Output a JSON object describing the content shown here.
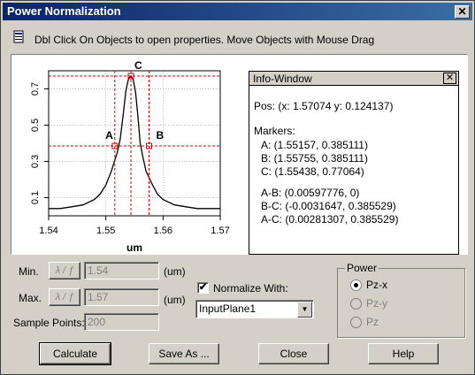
{
  "window": {
    "title": "Power Normalization"
  },
  "hint": "Dbl Click On Objects to open properties.  Move Objects with Mouse Drag",
  "chart_data": {
    "type": "line",
    "xlabel": "um",
    "ylabel": "",
    "xlim": [
      1.54,
      1.57
    ],
    "ylim": [
      0,
      0.8
    ],
    "x_ticks": [
      "1.54",
      "1.55",
      "1.56",
      "1.57"
    ],
    "y_ticks": [
      "0.1",
      "0.3",
      "0.5",
      "0.7"
    ],
    "series": [
      {
        "x": [
          1.54,
          1.542,
          1.544,
          1.546,
          1.548,
          1.549,
          1.55,
          1.551,
          1.552,
          1.5525,
          1.553,
          1.5535,
          1.554,
          1.5544,
          1.5548,
          1.5552,
          1.5556,
          1.556,
          1.5565,
          1.557,
          1.558,
          1.559,
          1.56,
          1.562,
          1.564,
          1.566,
          1.568,
          1.57
        ],
        "y": [
          0.04,
          0.04,
          0.05,
          0.06,
          0.09,
          0.12,
          0.17,
          0.25,
          0.35,
          0.42,
          0.55,
          0.69,
          0.76,
          0.77,
          0.75,
          0.68,
          0.55,
          0.4,
          0.32,
          0.25,
          0.18,
          0.12,
          0.09,
          0.06,
          0.05,
          0.04,
          0.04,
          0.04
        ]
      }
    ],
    "markers": [
      {
        "name": "A",
        "x": 1.55157,
        "y": 0.385111
      },
      {
        "name": "B",
        "x": 1.55755,
        "y": 0.385111
      },
      {
        "name": "C",
        "x": 1.55438,
        "y": 0.77064
      }
    ]
  },
  "info": {
    "title": "Info-Window",
    "pos": "Pos:  (x: 1.57074  y: 0.124137)",
    "markers_label": "Markers:",
    "lines": [
      "A: (1.55157, 0.385111)",
      "B: (1.55755, 0.385111)",
      "C: (1.55438, 0.77064)"
    ],
    "diffs": [
      "A-B: (0.00597776, 0)",
      "B-C: (-0.0031647, 0.385529)",
      "A-C: (0.00281307, 0.385529)"
    ]
  },
  "controls": {
    "min_label": "Min.",
    "max_label": "Max.",
    "lambda_btn": "λ / ƒ",
    "min_value": "1.54",
    "max_value": "1.57",
    "unit": "(um)",
    "sample_label": "Sample Points:",
    "sample_value": "200",
    "normalize_label": "Normalize With:",
    "normalize_checked": "✔",
    "normalize_value": "InputPlane1",
    "power_group": "Power",
    "power_options": [
      "Pz-x",
      "Pz-y",
      "Pz"
    ]
  },
  "buttons": {
    "calculate": "Calculate",
    "save_as": "Save As ...",
    "close": "Close",
    "help": "Help"
  }
}
